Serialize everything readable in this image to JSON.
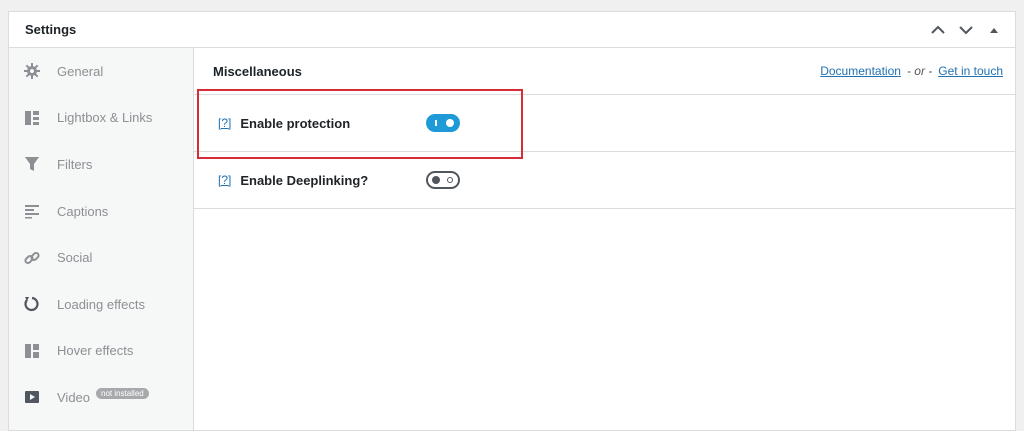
{
  "panel": {
    "title": "Settings"
  },
  "sidebar": {
    "items": [
      {
        "label": "General",
        "icon": "gear-icon"
      },
      {
        "label": "Lightbox & Links",
        "icon": "layout-icon"
      },
      {
        "label": "Filters",
        "icon": "filter-icon"
      },
      {
        "label": "Captions",
        "icon": "captions-icon"
      },
      {
        "label": "Social",
        "icon": "link-icon"
      },
      {
        "label": "Loading effects",
        "icon": "loading-icon"
      },
      {
        "label": "Hover effects",
        "icon": "hover-grid-icon"
      },
      {
        "label": "Video",
        "icon": "video-icon",
        "badge": "not installed"
      }
    ]
  },
  "content": {
    "title": "Miscellaneous",
    "links": {
      "documentation": "Documentation",
      "separator": "- or -",
      "contact": "Get in touch"
    },
    "rows": [
      {
        "help": "[?]",
        "label": "Enable protection",
        "enabled": true
      },
      {
        "help": "[?]",
        "label": "Enable Deeplinking?",
        "enabled": false
      }
    ]
  },
  "colors": {
    "accent": "#1e9ad6",
    "highlight": "#d62d37",
    "link": "#2271b1"
  }
}
